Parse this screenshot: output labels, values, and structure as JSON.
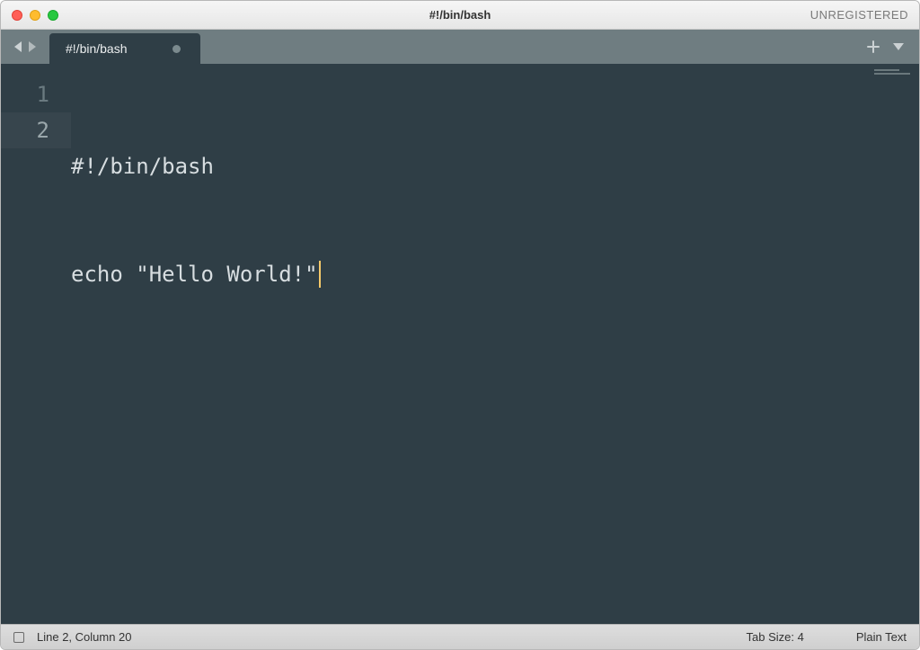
{
  "window": {
    "title": "#!/bin/bash",
    "registration_status": "UNREGISTERED"
  },
  "tabs": [
    {
      "label": "#!/bin/bash",
      "dirty": true
    }
  ],
  "editor": {
    "lines": [
      "#!/bin/bash",
      "echo \"Hello World!\""
    ],
    "line_numbers": [
      "1",
      "2"
    ],
    "active_line_index": 1
  },
  "status": {
    "cursor_position": "Line 2, Column 20",
    "tab_size": "Tab Size: 4",
    "syntax": "Plain Text"
  },
  "colors": {
    "editor_bg": "#2f3e46",
    "tabbar_bg": "#6f7d81",
    "text": "#d7dde0",
    "cursor": "#f5c96a"
  }
}
